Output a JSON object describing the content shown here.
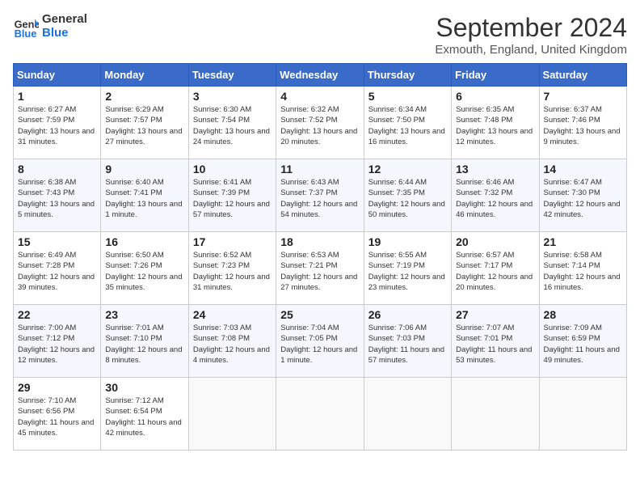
{
  "header": {
    "logo_line1": "General",
    "logo_line2": "Blue",
    "month_title": "September 2024",
    "location": "Exmouth, England, United Kingdom"
  },
  "weekdays": [
    "Sunday",
    "Monday",
    "Tuesday",
    "Wednesday",
    "Thursday",
    "Friday",
    "Saturday"
  ],
  "weeks": [
    [
      {
        "day": "1",
        "sunrise": "6:27 AM",
        "sunset": "7:59 PM",
        "daylight": "13 hours and 31 minutes."
      },
      {
        "day": "2",
        "sunrise": "6:29 AM",
        "sunset": "7:57 PM",
        "daylight": "13 hours and 27 minutes."
      },
      {
        "day": "3",
        "sunrise": "6:30 AM",
        "sunset": "7:54 PM",
        "daylight": "13 hours and 24 minutes."
      },
      {
        "day": "4",
        "sunrise": "6:32 AM",
        "sunset": "7:52 PM",
        "daylight": "13 hours and 20 minutes."
      },
      {
        "day": "5",
        "sunrise": "6:34 AM",
        "sunset": "7:50 PM",
        "daylight": "13 hours and 16 minutes."
      },
      {
        "day": "6",
        "sunrise": "6:35 AM",
        "sunset": "7:48 PM",
        "daylight": "13 hours and 12 minutes."
      },
      {
        "day": "7",
        "sunrise": "6:37 AM",
        "sunset": "7:46 PM",
        "daylight": "13 hours and 9 minutes."
      }
    ],
    [
      {
        "day": "8",
        "sunrise": "6:38 AM",
        "sunset": "7:43 PM",
        "daylight": "13 hours and 5 minutes."
      },
      {
        "day": "9",
        "sunrise": "6:40 AM",
        "sunset": "7:41 PM",
        "daylight": "13 hours and 1 minute."
      },
      {
        "day": "10",
        "sunrise": "6:41 AM",
        "sunset": "7:39 PM",
        "daylight": "12 hours and 57 minutes."
      },
      {
        "day": "11",
        "sunrise": "6:43 AM",
        "sunset": "7:37 PM",
        "daylight": "12 hours and 54 minutes."
      },
      {
        "day": "12",
        "sunrise": "6:44 AM",
        "sunset": "7:35 PM",
        "daylight": "12 hours and 50 minutes."
      },
      {
        "day": "13",
        "sunrise": "6:46 AM",
        "sunset": "7:32 PM",
        "daylight": "12 hours and 46 minutes."
      },
      {
        "day": "14",
        "sunrise": "6:47 AM",
        "sunset": "7:30 PM",
        "daylight": "12 hours and 42 minutes."
      }
    ],
    [
      {
        "day": "15",
        "sunrise": "6:49 AM",
        "sunset": "7:28 PM",
        "daylight": "12 hours and 39 minutes."
      },
      {
        "day": "16",
        "sunrise": "6:50 AM",
        "sunset": "7:26 PM",
        "daylight": "12 hours and 35 minutes."
      },
      {
        "day": "17",
        "sunrise": "6:52 AM",
        "sunset": "7:23 PM",
        "daylight": "12 hours and 31 minutes."
      },
      {
        "day": "18",
        "sunrise": "6:53 AM",
        "sunset": "7:21 PM",
        "daylight": "12 hours and 27 minutes."
      },
      {
        "day": "19",
        "sunrise": "6:55 AM",
        "sunset": "7:19 PM",
        "daylight": "12 hours and 23 minutes."
      },
      {
        "day": "20",
        "sunrise": "6:57 AM",
        "sunset": "7:17 PM",
        "daylight": "12 hours and 20 minutes."
      },
      {
        "day": "21",
        "sunrise": "6:58 AM",
        "sunset": "7:14 PM",
        "daylight": "12 hours and 16 minutes."
      }
    ],
    [
      {
        "day": "22",
        "sunrise": "7:00 AM",
        "sunset": "7:12 PM",
        "daylight": "12 hours and 12 minutes."
      },
      {
        "day": "23",
        "sunrise": "7:01 AM",
        "sunset": "7:10 PM",
        "daylight": "12 hours and 8 minutes."
      },
      {
        "day": "24",
        "sunrise": "7:03 AM",
        "sunset": "7:08 PM",
        "daylight": "12 hours and 4 minutes."
      },
      {
        "day": "25",
        "sunrise": "7:04 AM",
        "sunset": "7:05 PM",
        "daylight": "12 hours and 1 minute."
      },
      {
        "day": "26",
        "sunrise": "7:06 AM",
        "sunset": "7:03 PM",
        "daylight": "11 hours and 57 minutes."
      },
      {
        "day": "27",
        "sunrise": "7:07 AM",
        "sunset": "7:01 PM",
        "daylight": "11 hours and 53 minutes."
      },
      {
        "day": "28",
        "sunrise": "7:09 AM",
        "sunset": "6:59 PM",
        "daylight": "11 hours and 49 minutes."
      }
    ],
    [
      {
        "day": "29",
        "sunrise": "7:10 AM",
        "sunset": "6:56 PM",
        "daylight": "11 hours and 45 minutes."
      },
      {
        "day": "30",
        "sunrise": "7:12 AM",
        "sunset": "6:54 PM",
        "daylight": "11 hours and 42 minutes."
      },
      null,
      null,
      null,
      null,
      null
    ]
  ]
}
